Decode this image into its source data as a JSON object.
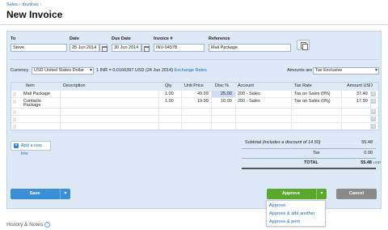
{
  "breadcrumb": {
    "items": [
      "Sales",
      "Invoices"
    ],
    "separator": "›"
  },
  "page_title": "New Invoice",
  "header": {
    "to_label": "To",
    "to_value": "Steve",
    "date_label": "Date",
    "date_value": "25 Jun 2014",
    "due_label": "Due Date",
    "due_value": "30 Jun 2014",
    "invoice_label": "Invoice #",
    "invoice_value": "INV-0457B",
    "reference_label": "Reference",
    "reference_value": "Mail Package"
  },
  "currency": {
    "label": "Currency",
    "value": "USD United States Dollar",
    "rate_text": "1 INR = 0.0166397 USD (24 Jun 2014)",
    "exchange_link": "Exchange Rates"
  },
  "amounts_are": {
    "label": "Amounts are",
    "value": "Tax Exclusive"
  },
  "columns": [
    "Item",
    "Description",
    "Qty",
    "Unit Price",
    "Disc %",
    "Account",
    "Tax Rate",
    "Amount USD"
  ],
  "rows": [
    {
      "item": "Mail Package",
      "description": "",
      "qty": "1.00",
      "unit_price": "49.99",
      "disc": "25.00",
      "account": "200 - Sales",
      "tax_rate": "Tax on Sales (0%)",
      "amount": "37.49"
    },
    {
      "item": "Contacts",
      "item2": "Package",
      "description": "",
      "qty": "1.00",
      "unit_price": "19.99",
      "disc": "10.00",
      "account": "200 - Sales",
      "tax_rate": "Tax on Sales (0%)",
      "amount": "17.99"
    }
  ],
  "add_line_label": "Add a new line",
  "totals": {
    "subtotal_label": "Subtotal",
    "subtotal_note": "(includes a discount of 14.50)",
    "subtotal_value": "55.48",
    "tax_label": "Tax",
    "tax_value": "0.00",
    "total_label": "TOTAL",
    "total_value": "55.48",
    "total_currency": "USD"
  },
  "buttons": {
    "save": "Save",
    "approve": "Approve",
    "cancel": "Cancel"
  },
  "approve_menu": [
    "Approve",
    "Approve & add another",
    "Approve & print"
  ],
  "history_label": "History & Notes",
  "colors": {
    "accent": "#3b8fd6",
    "approve": "#5aa92e",
    "cancel": "#8a8a8a",
    "panel": "#dde9f6",
    "link": "#1a6eb5"
  }
}
